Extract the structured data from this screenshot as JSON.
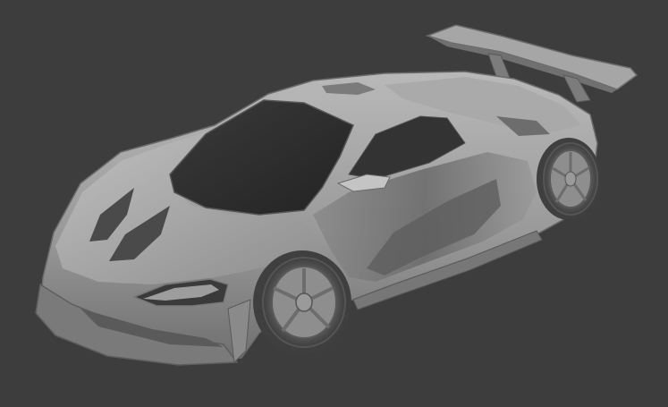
{
  "viewport": {
    "background_color": "#3d3d3d"
  },
  "model": {
    "shading": "solid",
    "body_color": "#8e8e8e",
    "highlight_color": "#b6b6b6",
    "shadow_color": "#5a5a5a",
    "glass_color": "#2c2c2c",
    "tire_color": "#4a4a4a",
    "rim_color": "#8a8a8a"
  }
}
